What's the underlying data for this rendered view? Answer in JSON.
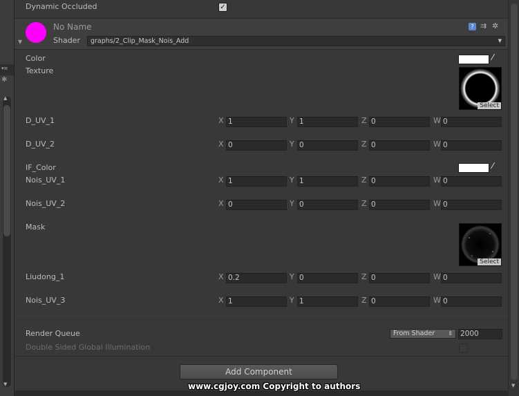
{
  "top": {
    "dynamic_occluded_label": "Dynamic Occluded",
    "dynamic_occluded_checked": "✓"
  },
  "material": {
    "name": "No Name",
    "shader_label": "Shader",
    "shader_value": "graphs/2_Clip_Mask_Nois_Add",
    "icon_color": "#ff00ff"
  },
  "properties": {
    "color_label": "Color",
    "texture_label": "Texture",
    "if_color_label": "IF_Color",
    "mask_label": "Mask",
    "select_label": "Select",
    "vectors": [
      {
        "label": "D_UV_1",
        "x": "1",
        "y": "1",
        "z": "0",
        "w": "0"
      },
      {
        "label": "D_UV_2",
        "x": "0",
        "y": "0",
        "z": "0",
        "w": "0"
      },
      {
        "label": "Nois_UV_1",
        "x": "1",
        "y": "1",
        "z": "0",
        "w": "0"
      },
      {
        "label": "Nois_UV_2",
        "x": "0",
        "y": "0",
        "z": "0",
        "w": "0"
      },
      {
        "label": "Liudong_1",
        "x": "0.2",
        "y": "0",
        "z": "0",
        "w": "0"
      },
      {
        "label": "Nois_UV_3",
        "x": "1",
        "y": "1",
        "z": "0",
        "w": "0"
      }
    ],
    "axis_labels": {
      "x": "X",
      "y": "Y",
      "z": "Z",
      "w": "W"
    }
  },
  "render_queue": {
    "label": "Render Queue",
    "mode": "From Shader",
    "value": "2000"
  },
  "double_sided": {
    "label": "Double Sided Global Illumination"
  },
  "add_component_label": "Add Component",
  "watermark": "www.cgjoy.com Copyright to authors"
}
